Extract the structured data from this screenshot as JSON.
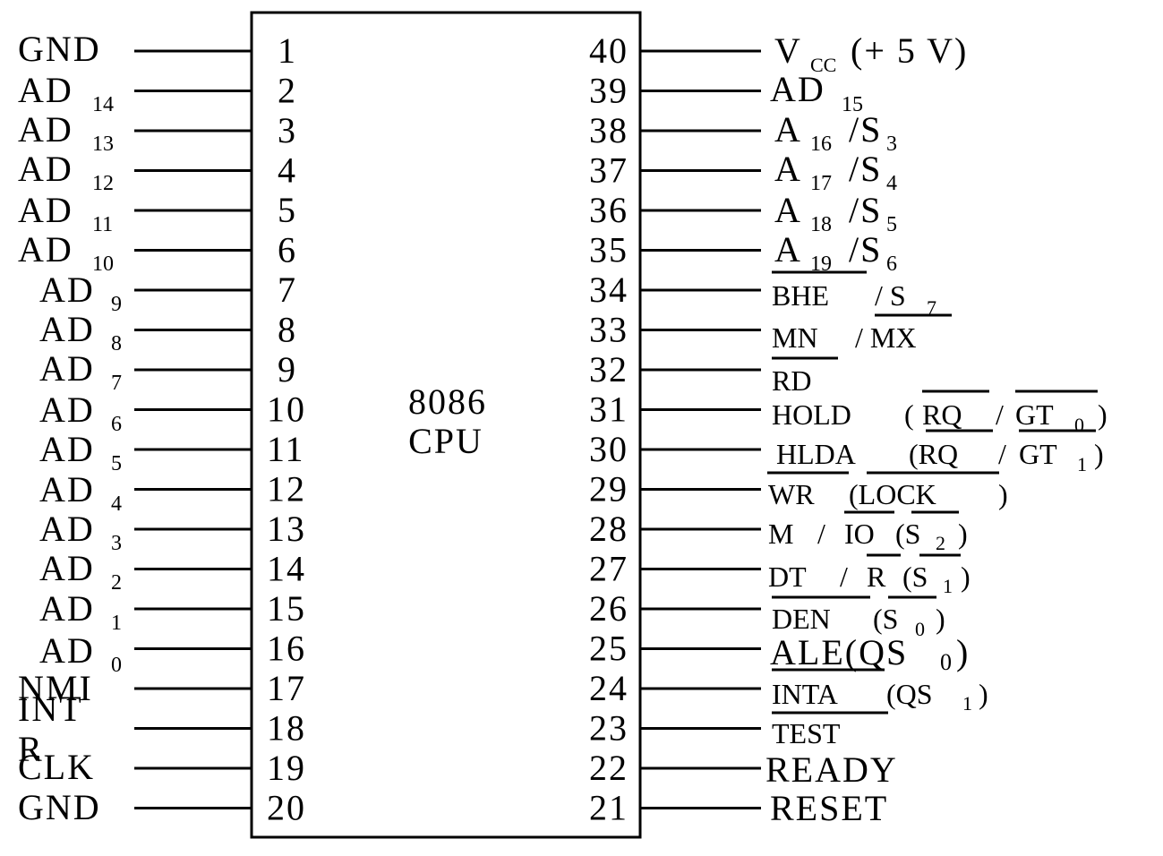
{
  "chip": {
    "name": "8086",
    "type": "CPU"
  },
  "left_pins": [
    {
      "pin": "1",
      "parts": [
        "GND"
      ]
    },
    {
      "pin": "2",
      "parts": [
        "AD",
        "14"
      ]
    },
    {
      "pin": "3",
      "parts": [
        "AD",
        "13"
      ]
    },
    {
      "pin": "4",
      "parts": [
        "AD",
        "12"
      ]
    },
    {
      "pin": "5",
      "parts": [
        "AD",
        "11"
      ]
    },
    {
      "pin": "6",
      "parts": [
        "AD",
        "10"
      ]
    },
    {
      "pin": "7",
      "parts": [
        "AD",
        "9"
      ]
    },
    {
      "pin": "8",
      "parts": [
        "AD",
        "8"
      ]
    },
    {
      "pin": "9",
      "parts": [
        "AD",
        "7"
      ]
    },
    {
      "pin": "10",
      "parts": [
        "AD",
        "6"
      ]
    },
    {
      "pin": "11",
      "parts": [
        "AD",
        "5"
      ]
    },
    {
      "pin": "12",
      "parts": [
        "AD",
        "4"
      ]
    },
    {
      "pin": "13",
      "parts": [
        "AD",
        "3"
      ]
    },
    {
      "pin": "14",
      "parts": [
        "AD",
        "2"
      ]
    },
    {
      "pin": "15",
      "parts": [
        "AD",
        "1"
      ]
    },
    {
      "pin": "16",
      "parts": [
        "AD",
        "0"
      ]
    },
    {
      "pin": "17",
      "parts": [
        "NMI"
      ]
    },
    {
      "pin": "18",
      "parts": [
        "INT",
        "R"
      ]
    },
    {
      "pin": "19",
      "parts": [
        "CLK"
      ]
    },
    {
      "pin": "20",
      "parts": [
        "GND"
      ]
    }
  ],
  "right_pins": [
    {
      "pin": "40",
      "parts": [
        "V",
        "CC",
        "(+ 5 V)"
      ]
    },
    {
      "pin": "39",
      "parts": [
        "AD",
        "15"
      ]
    },
    {
      "pin": "38",
      "parts": [
        "A",
        "16",
        "/S",
        "3"
      ]
    },
    {
      "pin": "37",
      "parts": [
        "A",
        "17",
        "/S",
        "4"
      ]
    },
    {
      "pin": "36",
      "parts": [
        "A",
        "18",
        "/S",
        "5"
      ]
    },
    {
      "pin": "35",
      "parts": [
        "A",
        "19",
        "/S",
        "6"
      ]
    },
    {
      "pin": "34",
      "parts": [
        "BHE",
        "/ S",
        "7"
      ]
    },
    {
      "pin": "33",
      "parts": [
        "MN",
        "/ MX"
      ]
    },
    {
      "pin": "32",
      "parts": [
        "RD"
      ]
    },
    {
      "pin": "31",
      "parts": [
        "HOLD",
        "(",
        "RQ",
        "/",
        "GT",
        "0",
        ")"
      ]
    },
    {
      "pin": "30",
      "parts": [
        "HLDA",
        "(RQ",
        "/",
        "GT",
        "1",
        ")"
      ]
    },
    {
      "pin": "29",
      "parts": [
        "WR",
        "(LOCK",
        ")"
      ]
    },
    {
      "pin": "28",
      "parts": [
        "M",
        "/",
        "IO",
        "(S",
        "2",
        ")"
      ]
    },
    {
      "pin": "27",
      "parts": [
        "DT",
        "/",
        "R",
        "(S",
        "1",
        ")"
      ]
    },
    {
      "pin": "26",
      "parts": [
        "DEN",
        "(S",
        "0",
        ")"
      ]
    },
    {
      "pin": "25",
      "parts": [
        "ALE(QS",
        "0",
        ")"
      ]
    },
    {
      "pin": "24",
      "parts": [
        "INTA",
        "(QS",
        "1",
        ")"
      ]
    },
    {
      "pin": "23",
      "parts": [
        "TEST"
      ]
    },
    {
      "pin": "22",
      "parts": [
        "READY"
      ]
    },
    {
      "pin": "21",
      "parts": [
        "RESET"
      ]
    }
  ]
}
